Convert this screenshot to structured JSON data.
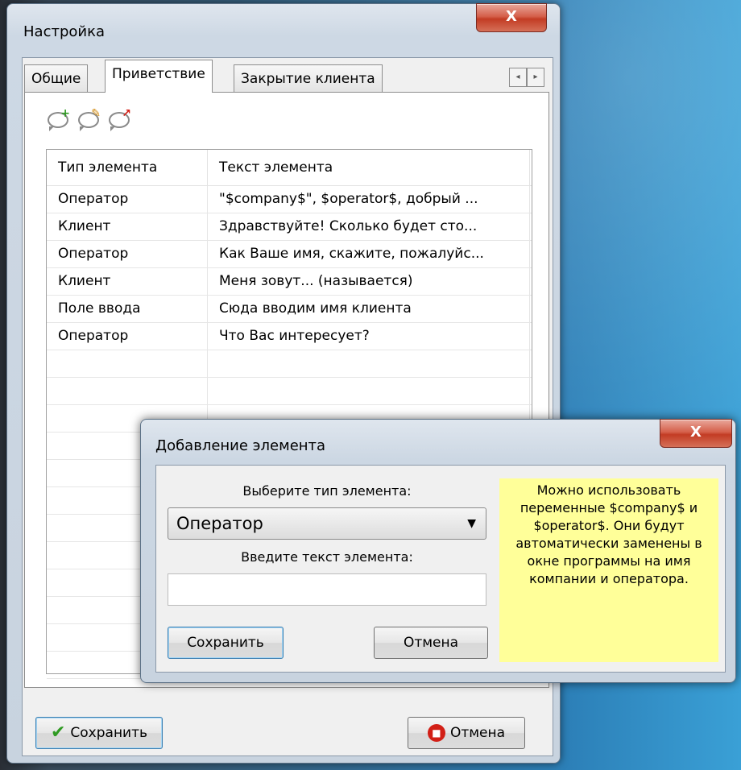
{
  "main_window": {
    "title": "Настройка",
    "close_label": "X",
    "tabs": [
      "Общие",
      "Приветствие",
      "Закрытие клиента"
    ],
    "active_tab": "Приветствие",
    "tab_scroll": [
      "◂",
      "▸"
    ],
    "toolbar_icons": [
      "add-message-icon",
      "edit-message-icon",
      "delete-message-icon"
    ],
    "table": {
      "headers": [
        "Тип элемента",
        "Текст элемента"
      ],
      "rows": [
        {
          "type": "Оператор",
          "text": "\"$company$\", $operator$, добрый ..."
        },
        {
          "type": "Клиент",
          "text": "Здравствуйте! Сколько будет сто..."
        },
        {
          "type": "Оператор",
          "text": "Как Ваше имя, скажите, пожалуйс..."
        },
        {
          "type": "Клиент",
          "text": "Меня зовут... (называется)"
        },
        {
          "type": "Поле ввода",
          "text": "Сюда вводим имя клиента"
        },
        {
          "type": "Оператор",
          "text": "Что Вас интересует?"
        }
      ]
    },
    "save_label": "Сохранить",
    "cancel_label": "Отмена"
  },
  "dialog": {
    "title": "Добавление элемента",
    "close_label": "X",
    "type_label": "Выберите тип элемента:",
    "type_value": "Оператор",
    "text_label": "Введите текст элемента:",
    "text_value": "",
    "save_label": "Сохранить",
    "cancel_label": "Отмена",
    "hint": "Можно использовать переменные $company$ и $operator$. Они будут автоматически заменены в окне программы на имя компании и оператора."
  },
  "colors": {
    "hint_bg": "#ffff99",
    "close_red": "#c33c24",
    "check_green": "#2f9a22",
    "stop_red": "#d21f16"
  }
}
